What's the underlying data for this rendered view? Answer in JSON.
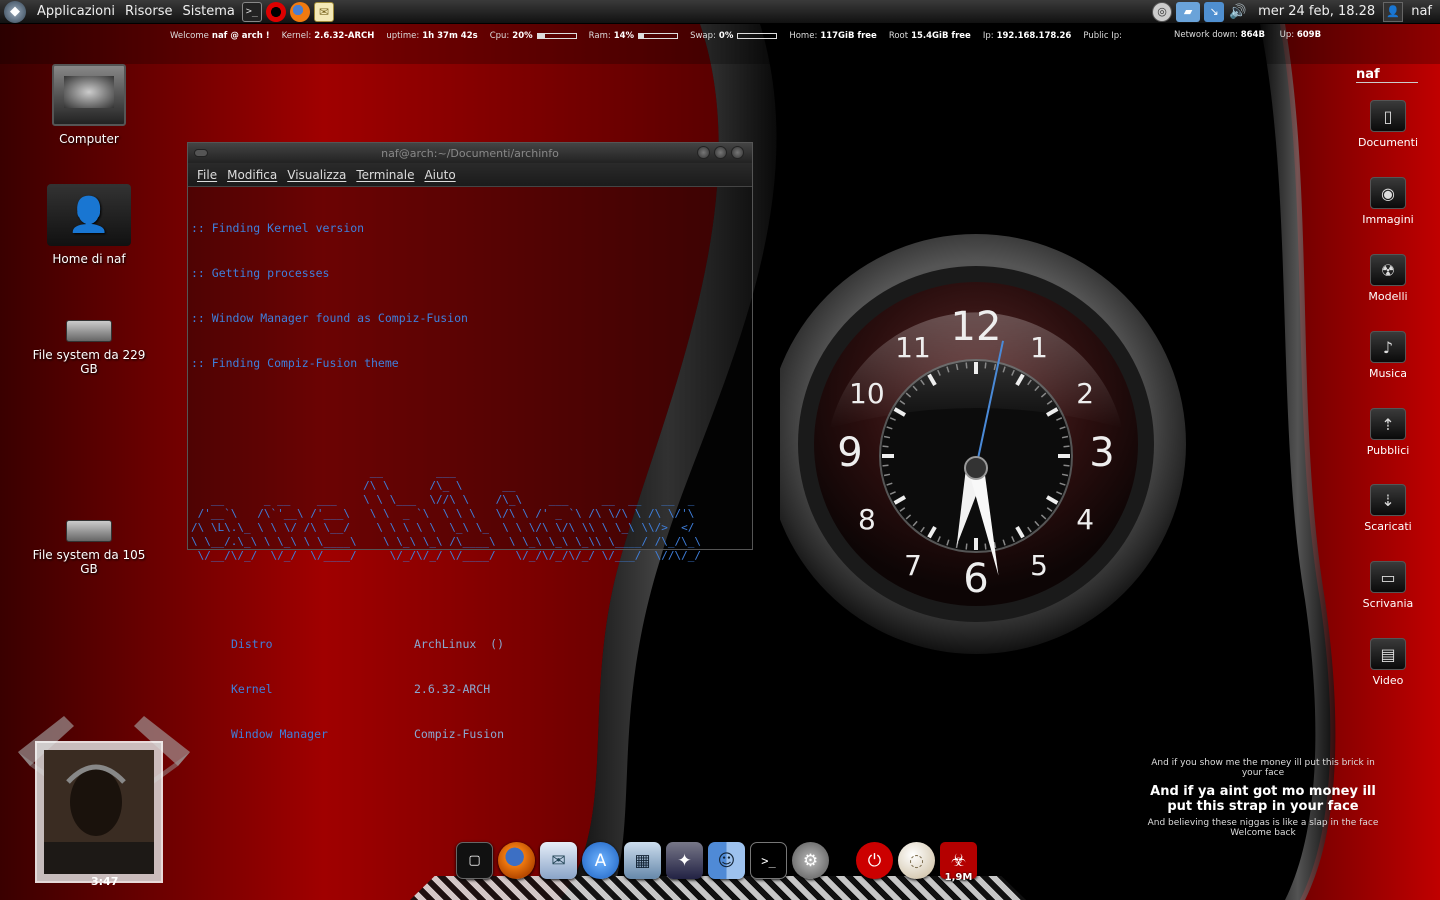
{
  "top_panel": {
    "menus": [
      "Applicazioni",
      "Risorse",
      "Sistema"
    ],
    "datetime": "mer 24 feb, 18.28",
    "user": "naf"
  },
  "conky": {
    "welcome_label": "Welcome",
    "welcome_user": "naf @ arch !",
    "kernel_label": "Kernel:",
    "kernel": "2.6.32-ARCH",
    "uptime_label": "uptime:",
    "uptime": "1h 37m 42s",
    "cpu_label": "Cpu:",
    "cpu": "20%",
    "cpu_fraction": 0.2,
    "ram_label": "Ram:",
    "ram": "14%",
    "ram_fraction": 0.14,
    "swap_label": "Swap:",
    "swap": "0%",
    "swap_fraction": 0.0,
    "home_label": "Home:",
    "home": "117GiB free",
    "root_label": "Root",
    "root": "15.4GiB free",
    "ip_label": "Ip:",
    "ip": "192.168.178.26",
    "public_ip_label": "Public Ip:",
    "net_down_label": "Network down:",
    "net_down": "864B",
    "net_up_label": "Up:",
    "net_up": "609B"
  },
  "desktop_icons": [
    {
      "label": "Computer",
      "icon": "computer-icon"
    },
    {
      "label": "Home di naf",
      "icon": "home-folder-icon"
    },
    {
      "label": "File system da 229 GB",
      "icon": "drive-icon"
    },
    {
      "label": "File system da 105 GB",
      "icon": "drive-icon"
    }
  ],
  "terminal": {
    "title": "naf@arch:~/Documenti/archinfo",
    "menu": [
      "File",
      "Modifica",
      "Visualizza",
      "Terminale",
      "Aiuto"
    ],
    "lines": [
      ":: Finding Kernel version",
      ":: Getting processes",
      ":: Window Manager found as Compiz-Fusion",
      ":: Finding Compiz-Fusion theme"
    ],
    "ascii_art": "                           __        ___\n                          /\\ \\      /\\_ \\      __\n   __      _ __    ___    \\ \\ \\___  \\//\\ \\    /\\_\\    ___     __  __   __  _\n /'__`\\   /\\`'__\\ /'___\\   \\ \\  _ `\\  \\ \\ \\   \\/\\ \\ /' _ `\\ /\\ \\/\\ \\ /\\ \\/'\\\n/\\ \\L\\.\\_ \\ \\ \\/ /\\ \\__/    \\ \\ \\ \\ \\  \\_\\ \\_  \\ \\ \\/\\ \\/\\ \\\\ \\ \\_\\ \\\\/>  </\n\\ \\__/.\\_\\ \\ \\_\\ \\ \\____\\    \\ \\_\\ \\_\\ /\\____\\  \\ \\_\\ \\_\\ \\_\\\\ \\____/ /\\_/\\_\\\n \\/__/\\/_/  \\/_/  \\/____/     \\/_/\\/_/ \\/____/   \\/_/\\/_/\\/_/ \\/___/  \\//\\/_/",
    "info": [
      {
        "key": "Distro",
        "value": "ArchLinux  ()"
      },
      {
        "key": "Kernel",
        "value": "2.6.32-ARCH"
      },
      {
        "key": "Window Manager",
        "value": "Compiz-Fusion"
      }
    ]
  },
  "clock": {
    "hour": 6,
    "minute": 28,
    "second": 2,
    "numerals": [
      "12",
      "1",
      "2",
      "3",
      "4",
      "5",
      "6",
      "7",
      "8",
      "9",
      "10",
      "11"
    ]
  },
  "places": {
    "title": "naf",
    "items": [
      {
        "label": "Documenti",
        "icon": "document-icon"
      },
      {
        "label": "Immagini",
        "icon": "camera-icon"
      },
      {
        "label": "Modelli",
        "icon": "radiation-icon"
      },
      {
        "label": "Musica",
        "icon": "music-note-icon"
      },
      {
        "label": "Pubblici",
        "icon": "share-icon"
      },
      {
        "label": "Scaricati",
        "icon": "download-icon"
      },
      {
        "label": "Scrivania",
        "icon": "desktop-icon"
      },
      {
        "label": "Video",
        "icon": "film-icon"
      }
    ]
  },
  "lyrics": {
    "line1": "And if you show me the money ill put this brick in your face",
    "line2": "And if ya aint got mo money ill put this strap in your face",
    "line3": "And believing these niggas is like a slap in the face",
    "line4": "Welcome back"
  },
  "album": {
    "time": "3:47"
  },
  "dock": {
    "items": [
      {
        "icon": "box-icon"
      },
      {
        "icon": "firefox-icon"
      },
      {
        "icon": "mail-icon"
      },
      {
        "icon": "app-store-icon"
      },
      {
        "icon": "clapperboard-icon"
      },
      {
        "icon": "game-icon"
      },
      {
        "icon": "finder-icon"
      },
      {
        "icon": "terminal-icon"
      },
      {
        "icon": "preferences-icon"
      },
      {
        "icon": "power-icon"
      },
      {
        "icon": "ball-icon"
      },
      {
        "icon": "biohazard-icon",
        "badge": "1,9M"
      }
    ]
  }
}
